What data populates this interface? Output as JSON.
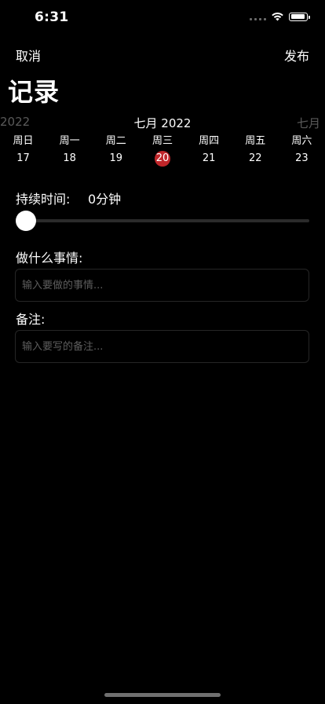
{
  "status": {
    "time": "6:31"
  },
  "nav": {
    "cancel": "取消",
    "publish": "发布"
  },
  "title": "记录",
  "calendar": {
    "prev_label": "2022",
    "current_label": "七月 2022",
    "next_label": "七月",
    "days": [
      {
        "name": "周日",
        "num": "17"
      },
      {
        "name": "周一",
        "num": "18"
      },
      {
        "name": "周二",
        "num": "19"
      },
      {
        "name": "周三",
        "num": "20",
        "selected": true
      },
      {
        "name": "周四",
        "num": "21"
      },
      {
        "name": "周五",
        "num": "22"
      },
      {
        "name": "周六",
        "num": "23"
      }
    ],
    "selected_color": "#c0262a"
  },
  "duration": {
    "label": "持续时间:",
    "value": "0分钟",
    "slider_fraction": 0
  },
  "task": {
    "label": "做什么事情:",
    "placeholder": "输入要做的事情...",
    "value": ""
  },
  "note": {
    "label": "备注:",
    "placeholder": "输入要写的备注...",
    "value": ""
  }
}
